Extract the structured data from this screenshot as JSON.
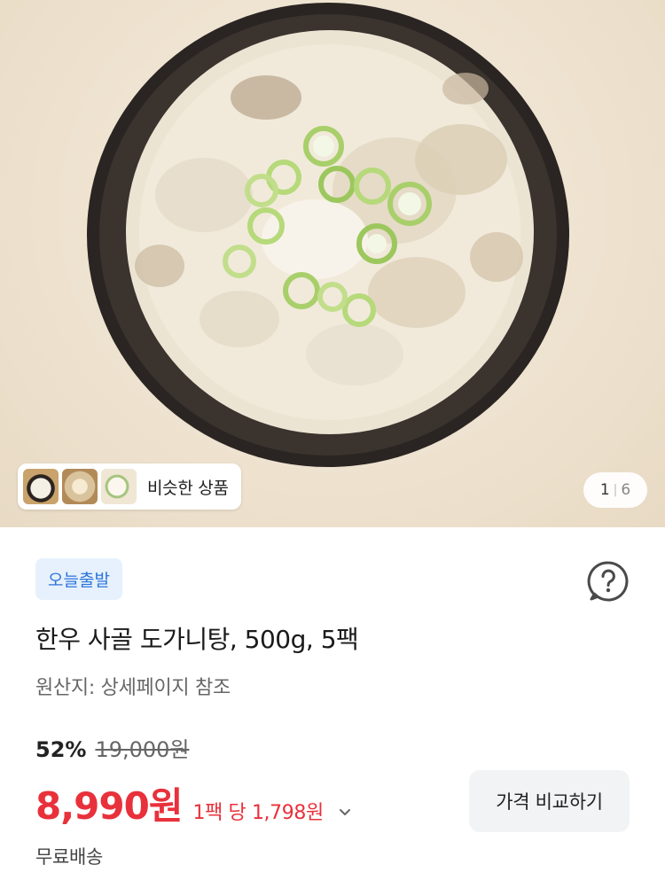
{
  "hero": {
    "image": "bowl-of-beef-bone-soup-with-green-onions",
    "similar_products_label": "비슷한 상품",
    "pager_current": "1",
    "pager_separator": "|",
    "pager_total": "6"
  },
  "product": {
    "badge": "오늘출발",
    "title": "한우 사골 도가니탕, 500g, 5팩",
    "origin": "원산지: 상세페이지 참조",
    "discount_rate": "52%",
    "original_price": "19,000원",
    "sale_price": "8,990원",
    "unit_price": "1팩 당 1,798원",
    "compare_button": "가격 비교하기",
    "shipping": "무료배송"
  },
  "colors": {
    "accent_red": "#e8313b",
    "badge_blue": "#2c74d9",
    "badge_bg": "#e6f1fd"
  },
  "icons": {
    "help": "question-circle-icon",
    "unit_price_toggle": "chevron-down-icon"
  }
}
